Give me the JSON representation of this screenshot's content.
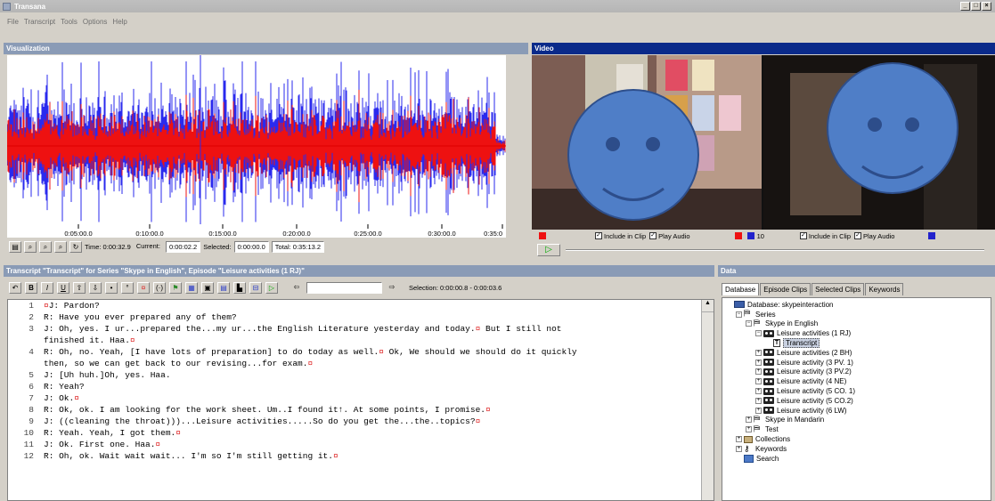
{
  "window": {
    "title": "Transana"
  },
  "menu": [
    "File",
    "Transcript",
    "Tools",
    "Options",
    "Help"
  ],
  "visualization": {
    "title": "Visualization",
    "time_ticks": [
      "0:05:00.0",
      "0:10:00.0",
      "0:15:00.0",
      "0:20:00.0",
      "0:25:00.0",
      "0:30:00.0",
      "0:35:0"
    ],
    "time_label": "Time: 0:00:32.9",
    "current_label": "Current:",
    "current_value": "0:00:02.2",
    "selected_label": "Selected:",
    "selected_value": "0:00:00.0",
    "total_label": "Total: 0:35:13.2",
    "colors": {
      "red": "#ee1111",
      "blue": "#2a2aee"
    }
  },
  "video": {
    "title": "Video",
    "include_clip": "Include in Clip",
    "play_audio": "Play Audio",
    "num_value": "10",
    "include_clip_2": "Include in Clip",
    "play_audio_2": "Play Audio",
    "face_color": "#4f7ec7"
  },
  "transcript": {
    "title": "Transcript \"Transcript\" for Series \"Skype in English\", Episode \"Leisure activities (1 RJ)\"",
    "selection": "Selection: 0:00:00.8 - 0:00:03.6",
    "lines": [
      {
        "n": "1",
        "text": "J: Pardon?",
        "pre": "¤"
      },
      {
        "n": "2",
        "text": "R: Have you ever prepared any of them?"
      },
      {
        "n": "3",
        "text": "J: Oh, yes. I ur...prepared the...my ur...the English Literature yesterday and today.¤ But I still not"
      },
      {
        "n": "",
        "text": "finished it. Haa.¤"
      },
      {
        "n": "4",
        "text": "R: Oh, no. Yeah, [I have lots of preparation] to do today as well.¤ Ok, We should we should do it quickly"
      },
      {
        "n": "",
        "text": "then, so we can get back to our revising...for exam.¤"
      },
      {
        "n": "5",
        "text": "J: [Uh huh.]Oh, yes. Haa."
      },
      {
        "n": "6",
        "text": "R: Yeah?"
      },
      {
        "n": "7",
        "text": "J: Ok.¤"
      },
      {
        "n": "8",
        "text": "R: Ok, ok. I am looking for the work sheet. Um..I found it↑. At some points, I promise.¤"
      },
      {
        "n": "9",
        "text": "J: ((cleaning the throat)))...Leisure activities.....So do you get the...the..topics?¤"
      },
      {
        "n": "10",
        "text": "R: Yeah. Yeah, I got them.¤"
      },
      {
        "n": "11",
        "text": "J: Ok. First one. Haa.¤"
      },
      {
        "n": "12",
        "text": "R: Oh, ok. Wait wait wait... I'm so I'm still getting it.¤"
      }
    ]
  },
  "data_panel": {
    "title": "Data",
    "tabs": [
      "Database",
      "Episode Clips",
      "Selected Clips",
      "Keywords"
    ],
    "tree": [
      {
        "depth": 0,
        "label": "Database: skypeinteraction",
        "icon": "db",
        "exp": ""
      },
      {
        "depth": 1,
        "label": "Series",
        "icon": "series",
        "exp": "-"
      },
      {
        "depth": 2,
        "label": "Skype in English",
        "icon": "series",
        "exp": "-"
      },
      {
        "depth": 3,
        "label": "Leisure activities (1 RJ)",
        "icon": "film",
        "exp": "-"
      },
      {
        "depth": 4,
        "label": "Transcript",
        "icon": "doc",
        "exp": "",
        "sel": true
      },
      {
        "depth": 3,
        "label": "Leisure activities (2 BH)",
        "icon": "film",
        "exp": "+"
      },
      {
        "depth": 3,
        "label": "Leisure activity (3 PV. 1)",
        "icon": "film",
        "exp": "+"
      },
      {
        "depth": 3,
        "label": "Leisure activity (3 PV.2)",
        "icon": "film",
        "exp": "+"
      },
      {
        "depth": 3,
        "label": "Leisure activity (4 NE)",
        "icon": "film",
        "exp": "+"
      },
      {
        "depth": 3,
        "label": "Leisure activity (5 CO. 1)",
        "icon": "film",
        "exp": "+"
      },
      {
        "depth": 3,
        "label": "Leisure activity (5 CO.2)",
        "icon": "film",
        "exp": "+"
      },
      {
        "depth": 3,
        "label": "Leisure activity (6 LW)",
        "icon": "film",
        "exp": "+"
      },
      {
        "depth": 2,
        "label": "Skype in Mandarin",
        "icon": "series",
        "exp": "+"
      },
      {
        "depth": 2,
        "label": "Test",
        "icon": "series",
        "exp": "+"
      },
      {
        "depth": 1,
        "label": "Collections",
        "icon": "box",
        "exp": "+"
      },
      {
        "depth": 1,
        "label": "Keywords",
        "icon": "key",
        "exp": "+"
      },
      {
        "depth": 1,
        "label": "Search",
        "icon": "search",
        "exp": ""
      }
    ]
  }
}
